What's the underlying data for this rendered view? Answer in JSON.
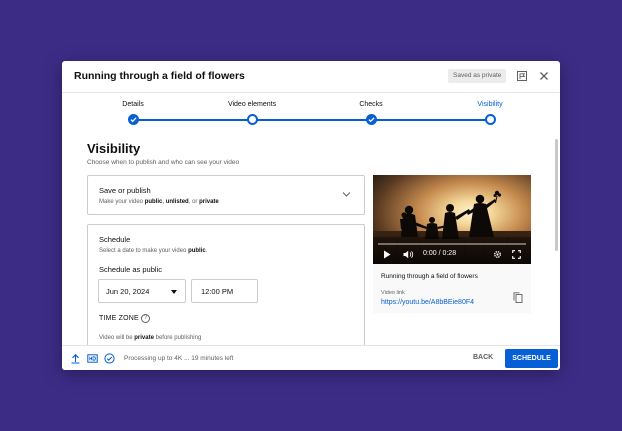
{
  "dialog": {
    "title": "Running through a field of flowers",
    "badge": "Saved as private"
  },
  "stepper": {
    "steps": [
      {
        "label": "Details",
        "state": "done"
      },
      {
        "label": "Video elements",
        "state": "open"
      },
      {
        "label": "Checks",
        "state": "done"
      },
      {
        "label": "Visibility",
        "state": "current"
      }
    ]
  },
  "visibility": {
    "title": "Visibility",
    "subtitle": "Choose when to publish and who can see your video"
  },
  "save_publish": {
    "title": "Save or publish",
    "desc_prefix": "Make your video ",
    "opt_public": "public",
    "sep1": ", ",
    "opt_unlisted": "unlisted",
    "sep2": ", or ",
    "opt_private": "private"
  },
  "schedule": {
    "title": "Schedule",
    "desc_prefix": "Select a date to make your video ",
    "desc_bold": "public",
    "desc_suffix": ".",
    "schedule_as": "Schedule as public",
    "date_value": "Jun 20, 2024",
    "time_value": "12:00 PM",
    "timezone_label": "TIME ZONE",
    "timezone_help": "?",
    "note_prefix": "Video will be ",
    "note_bold": "private",
    "note_suffix": " before publishing"
  },
  "video_card": {
    "current_time": "0:00 / 0:28",
    "progress": 0,
    "name": "Running through a field of flowers",
    "link_label": "Video link",
    "link": "https://youtu.be/A8bBEie80F4"
  },
  "footer": {
    "processing": "Processing up to 4K ... 19 minutes left",
    "back": "BACK",
    "schedule": "SCHEDULE"
  },
  "colors": {
    "background": "#3d2c86",
    "accent": "#065fd4",
    "text_secondary": "#606060"
  }
}
